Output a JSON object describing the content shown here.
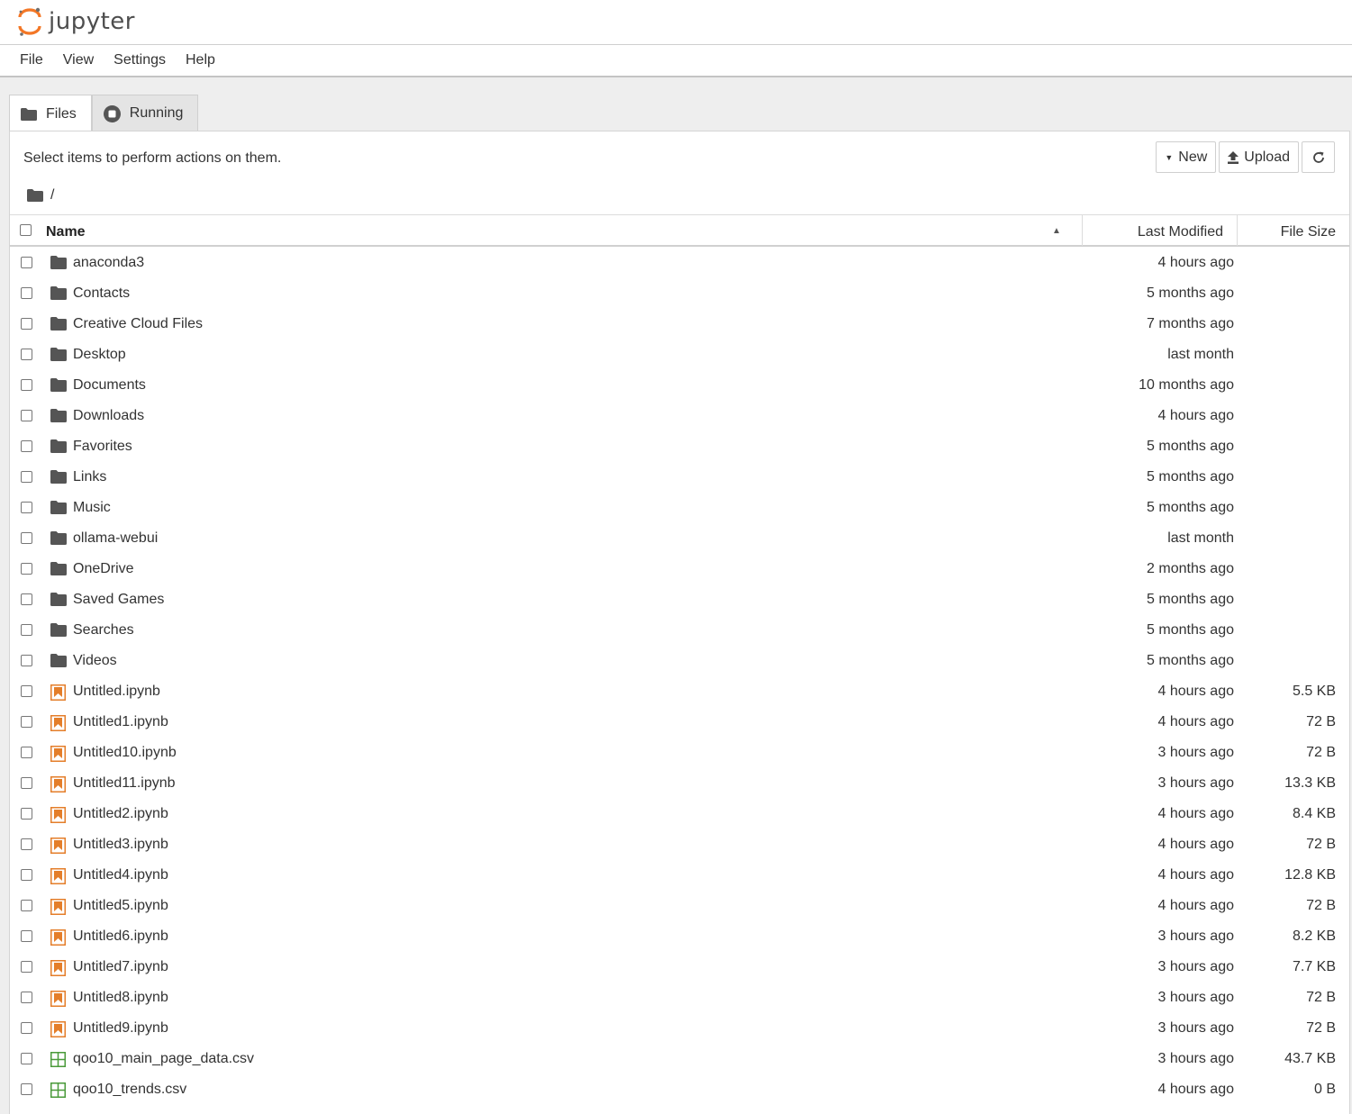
{
  "app": {
    "logo_text": "jupyter"
  },
  "menu": [
    "File",
    "View",
    "Settings",
    "Help"
  ],
  "tabs": [
    {
      "label": "Files",
      "icon": "folder-icon",
      "active": true
    },
    {
      "label": "Running",
      "icon": "stop-circle-icon",
      "active": false
    }
  ],
  "toolbar": {
    "hint": "Select items to perform actions on them.",
    "new_label": "New",
    "upload_label": "Upload"
  },
  "breadcrumb": {
    "path": "/"
  },
  "columns": {
    "name": "Name",
    "modified": "Last Modified",
    "size": "File Size"
  },
  "files": [
    {
      "name": "anaconda3",
      "type": "folder",
      "modified": "4 hours ago",
      "size": ""
    },
    {
      "name": "Contacts",
      "type": "folder",
      "modified": "5 months ago",
      "size": ""
    },
    {
      "name": "Creative Cloud Files",
      "type": "folder",
      "modified": "7 months ago",
      "size": ""
    },
    {
      "name": "Desktop",
      "type": "folder",
      "modified": "last month",
      "size": ""
    },
    {
      "name": "Documents",
      "type": "folder",
      "modified": "10 months ago",
      "size": ""
    },
    {
      "name": "Downloads",
      "type": "folder",
      "modified": "4 hours ago",
      "size": ""
    },
    {
      "name": "Favorites",
      "type": "folder",
      "modified": "5 months ago",
      "size": ""
    },
    {
      "name": "Links",
      "type": "folder",
      "modified": "5 months ago",
      "size": ""
    },
    {
      "name": "Music",
      "type": "folder",
      "modified": "5 months ago",
      "size": ""
    },
    {
      "name": "ollama-webui",
      "type": "folder",
      "modified": "last month",
      "size": ""
    },
    {
      "name": "OneDrive",
      "type": "folder",
      "modified": "2 months ago",
      "size": ""
    },
    {
      "name": "Saved Games",
      "type": "folder",
      "modified": "5 months ago",
      "size": ""
    },
    {
      "name": "Searches",
      "type": "folder",
      "modified": "5 months ago",
      "size": ""
    },
    {
      "name": "Videos",
      "type": "folder",
      "modified": "5 months ago",
      "size": ""
    },
    {
      "name": "Untitled.ipynb",
      "type": "notebook",
      "modified": "4 hours ago",
      "size": "5.5 KB"
    },
    {
      "name": "Untitled1.ipynb",
      "type": "notebook",
      "modified": "4 hours ago",
      "size": "72 B"
    },
    {
      "name": "Untitled10.ipynb",
      "type": "notebook",
      "modified": "3 hours ago",
      "size": "72 B"
    },
    {
      "name": "Untitled11.ipynb",
      "type": "notebook",
      "modified": "3 hours ago",
      "size": "13.3 KB"
    },
    {
      "name": "Untitled2.ipynb",
      "type": "notebook",
      "modified": "4 hours ago",
      "size": "8.4 KB"
    },
    {
      "name": "Untitled3.ipynb",
      "type": "notebook",
      "modified": "4 hours ago",
      "size": "72 B"
    },
    {
      "name": "Untitled4.ipynb",
      "type": "notebook",
      "modified": "4 hours ago",
      "size": "12.8 KB"
    },
    {
      "name": "Untitled5.ipynb",
      "type": "notebook",
      "modified": "4 hours ago",
      "size": "72 B"
    },
    {
      "name": "Untitled6.ipynb",
      "type": "notebook",
      "modified": "3 hours ago",
      "size": "8.2 KB"
    },
    {
      "name": "Untitled7.ipynb",
      "type": "notebook",
      "modified": "3 hours ago",
      "size": "7.7 KB"
    },
    {
      "name": "Untitled8.ipynb",
      "type": "notebook",
      "modified": "3 hours ago",
      "size": "72 B"
    },
    {
      "name": "Untitled9.ipynb",
      "type": "notebook",
      "modified": "3 hours ago",
      "size": "72 B"
    },
    {
      "name": "qoo10_main_page_data.csv",
      "type": "csv",
      "modified": "3 hours ago",
      "size": "43.7 KB"
    },
    {
      "name": "qoo10_trends.csv",
      "type": "csv",
      "modified": "4 hours ago",
      "size": "0 B"
    }
  ],
  "colors": {
    "logo_orange": "#f37726",
    "notebook_orange": "#e47e2a",
    "csv_green": "#4a9a3a",
    "folder_gray": "#555555"
  }
}
